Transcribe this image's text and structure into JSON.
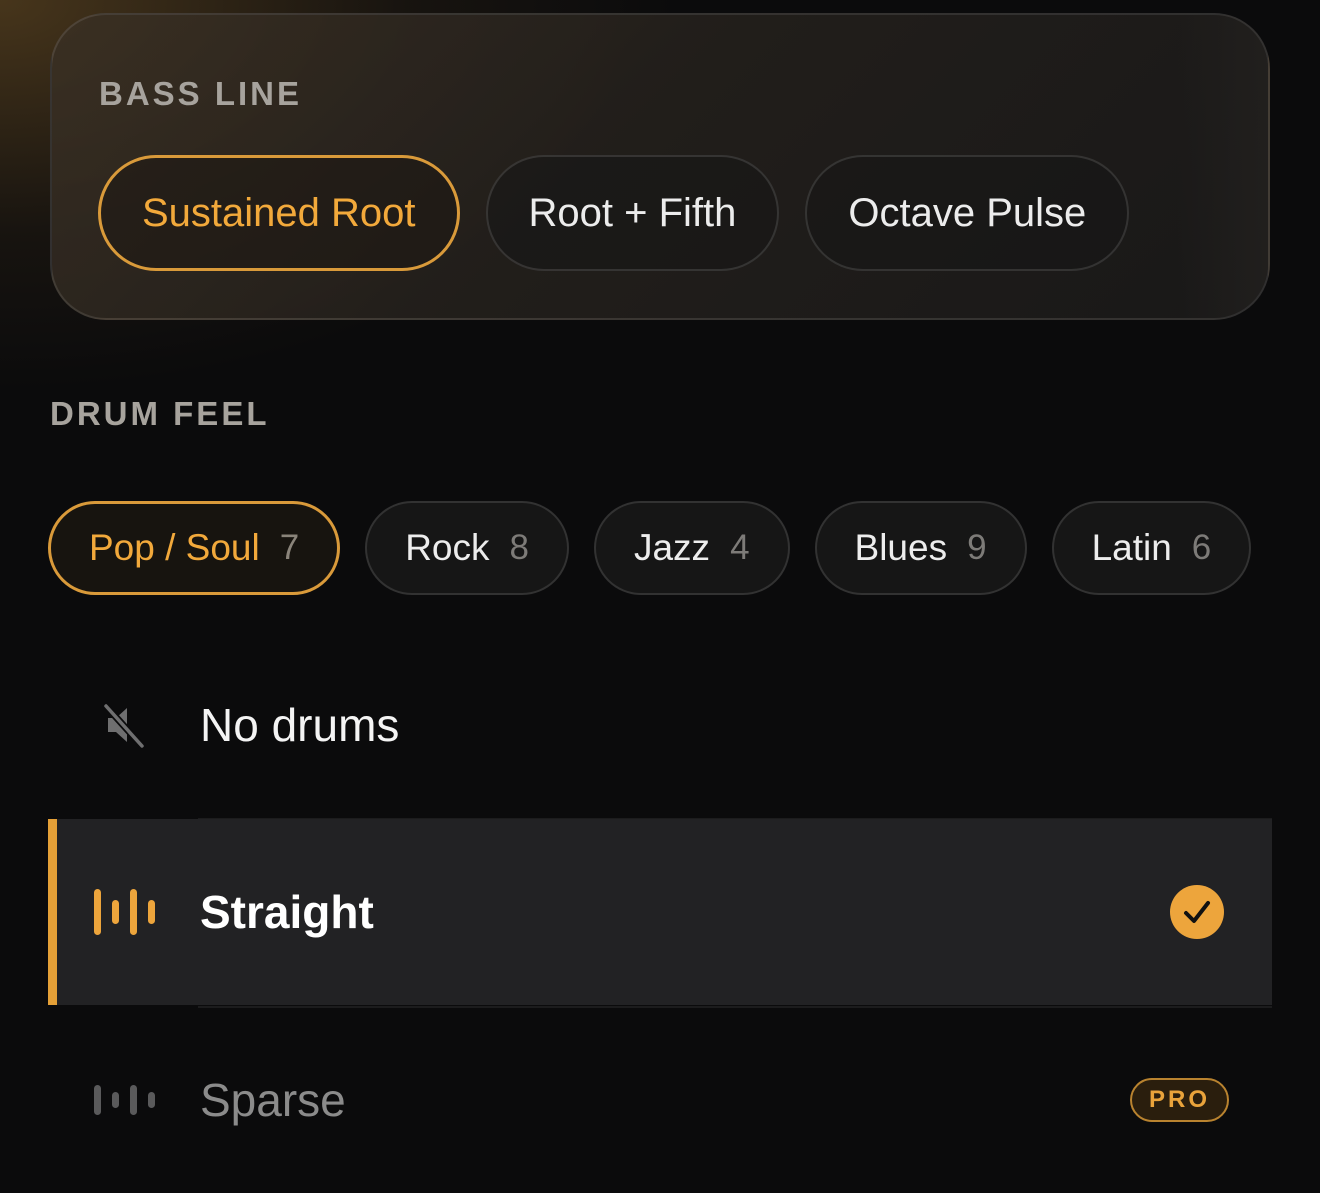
{
  "colors": {
    "accent": "#eda53c",
    "background": "#0b0b0c",
    "selected_row": "#222224"
  },
  "bass_line": {
    "label": "BASS LINE",
    "options": [
      {
        "label": "Sustained Root",
        "selected": true
      },
      {
        "label": "Root + Fifth",
        "selected": false
      },
      {
        "label": "Octave Pulse",
        "selected": false
      }
    ]
  },
  "drum_feel": {
    "label": "DRUM FEEL",
    "genres": [
      {
        "label": "Pop / Soul",
        "count": "7",
        "selected": true
      },
      {
        "label": "Rock",
        "count": "8",
        "selected": false
      },
      {
        "label": "Jazz",
        "count": "4",
        "selected": false
      },
      {
        "label": "Blues",
        "count": "9",
        "selected": false
      },
      {
        "label": "Latin",
        "count": "6",
        "selected": false
      }
    ],
    "patterns": [
      {
        "label": "No drums",
        "icon": "muted-speaker-icon",
        "selected": false
      },
      {
        "label": "Straight",
        "icon": "rhythm-bars-icon",
        "selected": true,
        "status_icon": "checkmark-icon"
      },
      {
        "label": "Sparse",
        "icon": "rhythm-bars-icon",
        "selected": false,
        "badge": "PRO"
      }
    ]
  }
}
